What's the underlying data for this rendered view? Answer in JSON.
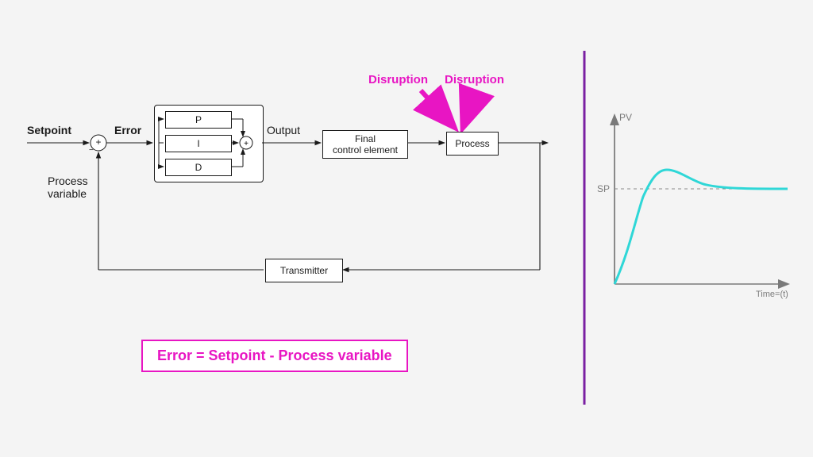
{
  "labels": {
    "setpoint": "Setpoint",
    "error": "Error",
    "output": "Output",
    "process_variable": "Process\nvariable",
    "disruption1": "Disruption",
    "disruption2": "Disruption"
  },
  "blocks": {
    "p": "P",
    "i": "I",
    "d": "D",
    "fce": "Final\ncontrol element",
    "process": "Process",
    "transmitter": "Transmitter"
  },
  "formula": "Error = Setpoint - Process variable",
  "colors": {
    "accent": "#e815c3",
    "curve": "#2fd7d7",
    "axis": "#7a7a7a",
    "divider": "#7a1fa2"
  },
  "chart_data": {
    "type": "line",
    "title": "",
    "xlabel": "Time=(t)",
    "ylabel": "PV",
    "sp_label": "SP",
    "curve_description": "step response rising from 0, overshooting SP slightly, then settling at SP",
    "x": [
      0,
      1,
      2,
      3,
      4,
      5,
      6,
      7,
      8,
      9,
      10,
      11,
      12,
      13,
      14,
      15,
      16,
      17,
      18,
      19,
      20
    ],
    "y": [
      0,
      0.25,
      0.55,
      0.82,
      1.0,
      1.1,
      1.13,
      1.1,
      1.07,
      1.04,
      1.02,
      1.01,
      1.0,
      1.0,
      1.0,
      1.0,
      1.0,
      1.0,
      1.0,
      1.0,
      1.0
    ],
    "sp": 1.0,
    "ylim": [
      0,
      1.3
    ]
  }
}
